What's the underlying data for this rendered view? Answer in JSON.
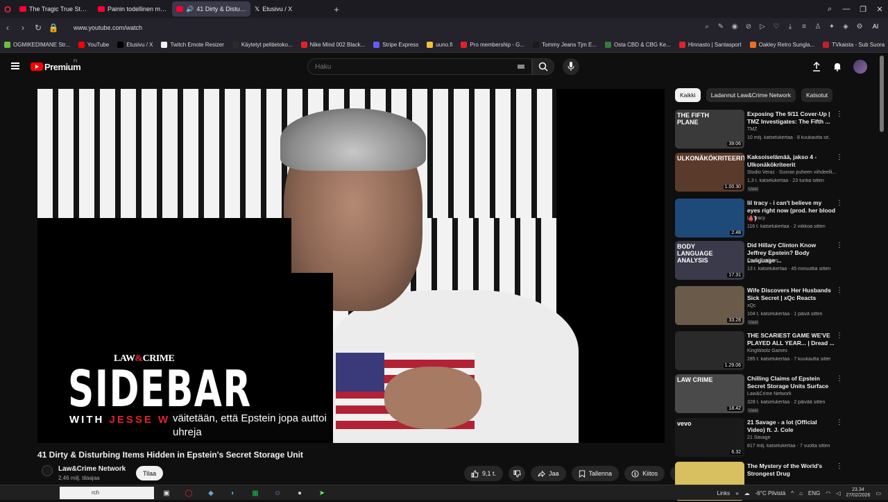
{
  "browser": {
    "tabs": [
      {
        "label": "The Tragic True Story of Ju",
        "icon": "youtube-icon",
        "active": false
      },
      {
        "label": "Painin todellinen merkitys",
        "icon": "youtube-icon",
        "active": false
      },
      {
        "label": "41 Dirty & Disturbing",
        "icon": "youtube-icon",
        "active": true
      },
      {
        "label": "Etusivu / X",
        "icon": "x-icon",
        "active": false
      }
    ],
    "new_tab": "+",
    "url": "www.youtube.com/watch",
    "ai_label": "AI",
    "bookmarks": [
      {
        "label": "OGMIKEDIMANE Str...",
        "color": "#6bbf3a"
      },
      {
        "label": "YouTube",
        "color": "#ff0000"
      },
      {
        "label": "Etusivu / X",
        "color": "#000000"
      },
      {
        "label": "Twitch Emote Resizer",
        "color": "#f1f1f1"
      },
      {
        "label": "Käytetyt pelitietoko...",
        "color": "#2b2b2b"
      },
      {
        "label": "Nike Mind 002 Black...",
        "color": "#e5202e"
      },
      {
        "label": "Stripe Express",
        "color": "#635bff"
      },
      {
        "label": "uuno.fi",
        "color": "#f0c23a"
      },
      {
        "label": "Pro membership - G...",
        "color": "#e5202e"
      },
      {
        "label": "Tommy Jeans Tjm E...",
        "color": "#1a1a1a"
      },
      {
        "label": "Osta CBD & CBG Ke...",
        "color": "#3a7a3a"
      },
      {
        "label": "Hinnasto | Santasport",
        "color": "#e5202e"
      },
      {
        "label": "Oakley Retro Sungla...",
        "color": "#f07020"
      },
      {
        "label": "TVkaista - Sub Suora",
        "color": "#c0202a"
      }
    ]
  },
  "youtube": {
    "logo_text": "Premium",
    "logo_region": "FI",
    "search_placeholder": "Haku",
    "video": {
      "overlay_brand_left": "LAW",
      "overlay_brand_amp": "&",
      "overlay_brand_right": "CRIME",
      "overlay_title": "SIDEBAR",
      "overlay_with": "WITH ",
      "overlay_host": "JESSE W",
      "caption_line1": "väitetään, että Epstein jopa auttoi",
      "caption_line2": "uhreja"
    },
    "title": "41 Dirty & Disturbing Items Hidden in Epstein's Secret Storage Unit",
    "channel": {
      "name": "Law&Crime Network",
      "subscribers": "2,46 milj. tilaajaa",
      "subscribe_label": "Tilaa"
    },
    "actions": {
      "likes": "9,1 t.",
      "share": "Jaa",
      "save": "Tallenna",
      "thanks": "Kiitos",
      "more": "…"
    },
    "chips": [
      "Kaikki",
      "Ladannut Law&Crime Network",
      "Katsotut"
    ],
    "recommendations": [
      {
        "title": "Exposing The 9/11 Cover-Up | TMZ Investigates: The Fifth ...",
        "channel": "TMZ",
        "meta": "10 milj. katselukertaa · 8 kuukautta sit...",
        "duration": "39:06",
        "badge": "",
        "thumb_color": "#3a3a3a",
        "thumb_text": "THE FIFTH PLANE"
      },
      {
        "title": "Kaksoiselämää, jakso 4 - Ulkonäkökriteerit",
        "channel": "Studio Veraz · Suoran puheen viihdeelli...",
        "meta": "1,3 t. katselukertaa · 23 tuntia sitten",
        "duration": "1.00.30",
        "badge": "Uusi",
        "thumb_color": "#5a3a2a",
        "thumb_text": "ULKONÄKÖKRITEERIT"
      },
      {
        "title": "lil tracy - i can't believe my eyes right now (prod. her blood 🩸)",
        "channel": "Lil Tracy",
        "meta": "116 t. katselukertaa · 2 viikkoa sitten",
        "duration": "2.48",
        "badge": "",
        "thumb_color": "#1e4a7a",
        "thumb_text": ""
      },
      {
        "title": "Did Hillary Clinton Know Jeffrey Epstein? Body Language ...",
        "channel": "Dr. G Explains",
        "meta": "13 t. katselukertaa · 45 minuuttia sitten",
        "duration": "17.31",
        "badge": "",
        "thumb_color": "#3a3a4a",
        "thumb_text": "BODY LANGUAGE ANALYSIS"
      },
      {
        "title": "Wife Discovers Her Husbands Sick Secret | xQc Reacts",
        "channel": "xQc",
        "meta": "104 t. katselukertaa · 1 päivä sitten",
        "duration": "33.28",
        "badge": "Uusi",
        "thumb_color": "#6a5a4a",
        "thumb_text": ""
      },
      {
        "title": "THE SCARIEST GAME WE'VE PLAYED ALL YEAR... | Dread ...",
        "channel": "KingWoolz Games",
        "meta": "285 t. katselukertaa · 7 kuukautta sitten",
        "duration": "1.29.06",
        "badge": "",
        "thumb_color": "#2a2a2a",
        "thumb_text": ""
      },
      {
        "title": "Chilling Claims of Epstein Secret Storage Units Surface",
        "channel": "Law&Crime Network",
        "meta": "328 t. katselukertaa · 2 päivää sitten",
        "duration": "18.42",
        "badge": "Uusi",
        "thumb_color": "#4a4a4a",
        "thumb_text": "LAW CRIME"
      },
      {
        "title": "21 Savage - a lot (Official Video) ft. J. Cole",
        "channel": "21 Savage",
        "meta": "817 milj. katselukertaa · 7 vuotta sitten",
        "duration": "6.32",
        "badge": "",
        "thumb_color": "#1a1a1a",
        "thumb_text": "vevo"
      },
      {
        "title": "The Mystery of the World's Strongest Drug",
        "channel": "",
        "meta": "",
        "duration": "",
        "badge": "",
        "thumb_color": "#d8c060",
        "thumb_text": ""
      }
    ]
  },
  "taskbar": {
    "search_text": "rch",
    "links_label": "Links",
    "weather": "-6°C Pilvistä",
    "language": "ENG",
    "time": "23.34",
    "date": "27/02/2026"
  }
}
